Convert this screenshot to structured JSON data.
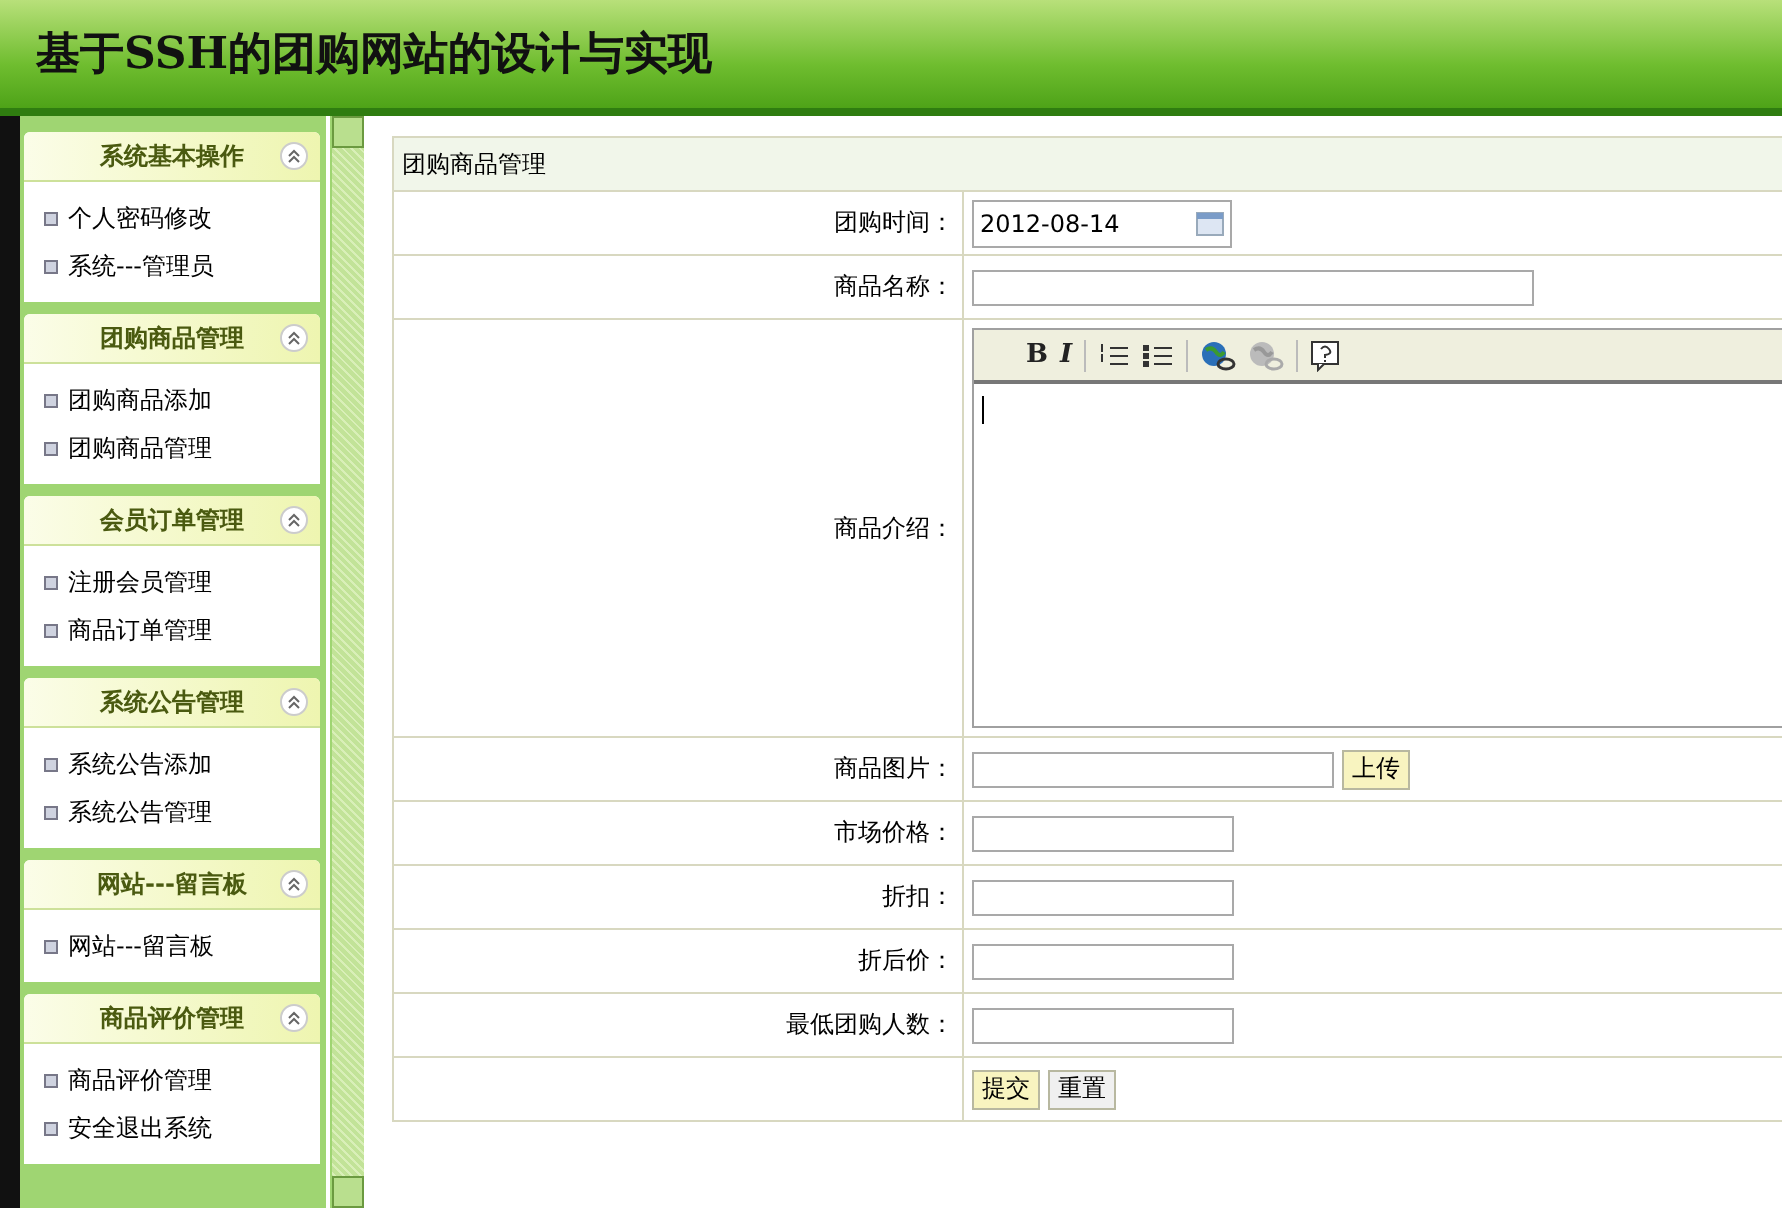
{
  "header": {
    "title": "基于SSH的团购网站的设计与实现"
  },
  "sidebar": {
    "groups": [
      {
        "title": "系统基本操作",
        "expanded": true,
        "items": [
          "个人密码修改",
          "系统---管理员"
        ]
      },
      {
        "title": "团购商品管理",
        "expanded": true,
        "items": [
          "团购商品添加",
          "团购商品管理"
        ]
      },
      {
        "title": "会员订单管理",
        "expanded": true,
        "items": [
          "注册会员管理",
          "商品订单管理"
        ]
      },
      {
        "title": "系统公告管理",
        "expanded": true,
        "items": [
          "系统公告添加",
          "系统公告管理"
        ]
      },
      {
        "title": "网站---留言板",
        "expanded": true,
        "items": [
          "网站---留言板"
        ]
      },
      {
        "title": "商品评价管理",
        "expanded": true,
        "items": [
          "商品评价管理",
          "安全退出系统"
        ]
      }
    ]
  },
  "form": {
    "title": "团购商品管理",
    "rows": [
      {
        "kind": "date",
        "label": "团购时间：",
        "value": "2012-08-14"
      },
      {
        "kind": "long-text",
        "label": "商品名称："
      },
      {
        "kind": "editor",
        "label": "商品介绍：",
        "toolbar": [
          {
            "kind": "bold",
            "text": "B",
            "disabled": false
          },
          {
            "kind": "italic",
            "text": "I",
            "disabled": false
          },
          {
            "kind": "sep"
          },
          {
            "kind": "ordered-list",
            "disabled": false
          },
          {
            "kind": "bullet-list",
            "disabled": false
          },
          {
            "kind": "sep"
          },
          {
            "kind": "link",
            "disabled": false
          },
          {
            "kind": "unlink",
            "disabled": true
          },
          {
            "kind": "sep"
          },
          {
            "kind": "help",
            "disabled": false
          }
        ]
      },
      {
        "kind": "file",
        "label": "商品图片：",
        "button": "上传"
      },
      {
        "kind": "text",
        "label": "市场价格："
      },
      {
        "kind": "text",
        "label": "折扣："
      },
      {
        "kind": "text",
        "label": "折后价："
      },
      {
        "kind": "text",
        "label": "最低团购人数："
      },
      {
        "kind": "buttons",
        "buttons": [
          {
            "text": "提交",
            "primary": true
          },
          {
            "text": "重置",
            "primary": false
          }
        ]
      }
    ]
  }
}
